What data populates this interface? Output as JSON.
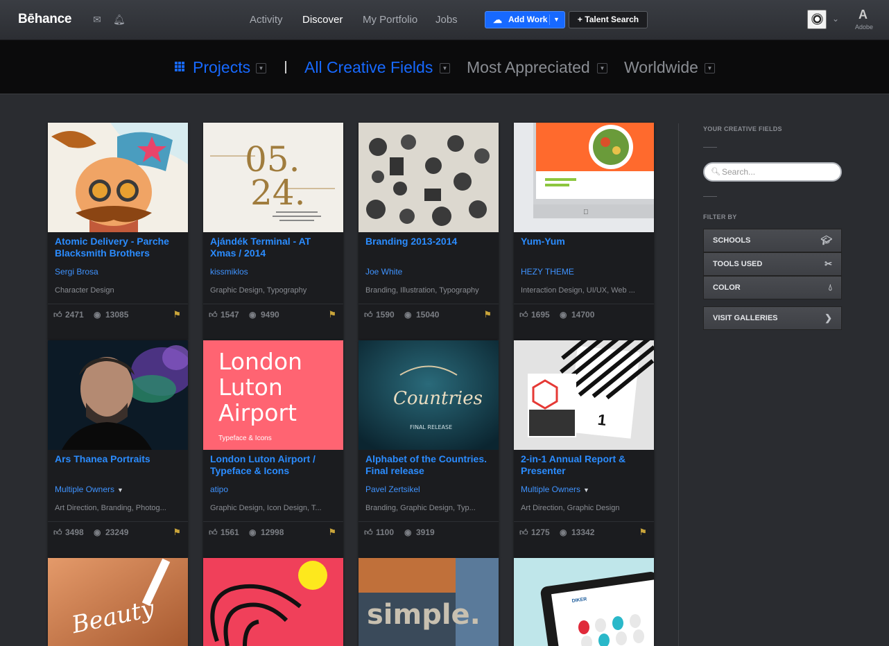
{
  "header": {
    "logo": "Bēhance",
    "nav": [
      "Activity",
      "Discover",
      "My Portfolio",
      "Jobs"
    ],
    "active_nav": "Discover",
    "add_work": "Add Work",
    "talent_search": "+ Talent Search",
    "adobe": "Adobe"
  },
  "filters": {
    "projects": "Projects",
    "fields": "All Creative Fields",
    "sort": "Most Appreciated",
    "location": "Worldwide"
  },
  "colors": {
    "accent": "#1769ff",
    "link": "#2b8cff",
    "featured": "#c9a43a"
  },
  "projects": [
    {
      "title": "Atomic Delivery - Parche Blacksmith Brothers",
      "owner": "Sergi Brosa",
      "fields": "Character Design",
      "likes": "2471",
      "views": "13085"
    },
    {
      "title": "Ajándék Terminal - AT Xmas / 2014",
      "owner": "kissmiklos",
      "fields": "Graphic Design, Typography",
      "likes": "1547",
      "views": "9490"
    },
    {
      "title": "Branding 2013-2014",
      "owner": "Joe White",
      "fields": "Branding, Illustration, Typography",
      "likes": "1590",
      "views": "15040"
    },
    {
      "title": "Yum-Yum",
      "owner": "HEZY THEME",
      "fields": "Interaction Design, UI/UX, Web ...",
      "likes": "1695",
      "views": "14700"
    },
    {
      "title": "Ars Thanea Portraits",
      "owner": "Multiple Owners",
      "fields": "Art Direction, Branding, Photog...",
      "likes": "3498",
      "views": "23249"
    },
    {
      "title": "London Luton Airport / Typeface & Icons",
      "owner": "atipo",
      "fields": "Graphic Design, Icon Design, T...",
      "likes": "1561",
      "views": "12998"
    },
    {
      "title": "Alphabet of the Countries. Final release",
      "owner": "Pavel Zertsikel",
      "fields": "Branding, Graphic Design, Typ...",
      "likes": "1100",
      "views": "3919"
    },
    {
      "title": "2-in-1 Annual Report & Presenter",
      "owner": "Multiple Owners",
      "fields": "Art Direction, Graphic Design",
      "likes": "1275",
      "views": "13342"
    }
  ],
  "thumb_text": {
    "p2a": "05.",
    "p2b": "24.",
    "p6": "London Luton Airport",
    "p6sub": "Typeface & Icons",
    "p7": "Countries",
    "p7sub": "FINAL RELEASE",
    "p9": "Beauty",
    "p11": "simple.",
    "p12": "DIKER"
  },
  "sidebar": {
    "fields_label": "YOUR CREATIVE FIELDS",
    "search_placeholder": "Search...",
    "filter_label": "FILTER BY",
    "schools": "SCHOOLS",
    "tools": "TOOLS USED",
    "color": "COLOR",
    "galleries": "VISIT GALLERIES"
  }
}
